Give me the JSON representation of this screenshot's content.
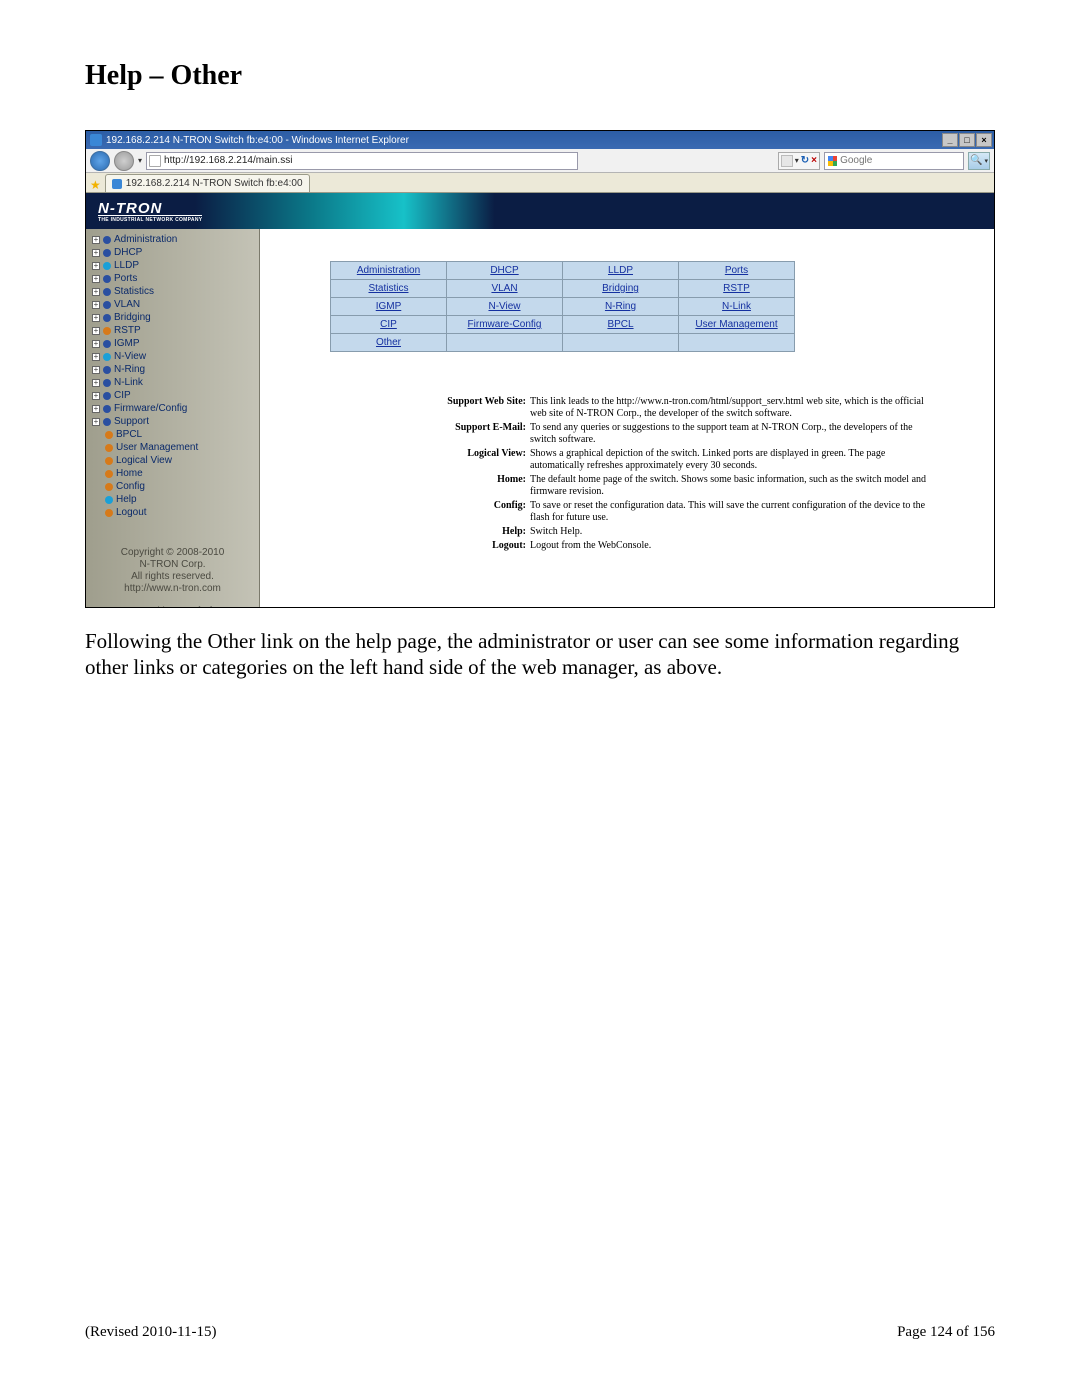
{
  "doc_title": "Help – Other",
  "ie": {
    "title": "192.168.2.214 N-TRON Switch fb:e4:00 - Windows Internet Explorer",
    "address": "http://192.168.2.214/main.ssi",
    "tab_label": "192.168.2.214 N-TRON Switch fb:e4:00",
    "search_placeholder": "Google",
    "min_label": "_",
    "max_label": "□",
    "close_label": "×",
    "refresh_label": "↻",
    "stop_label": "×",
    "dd_label": "▾",
    "mag_label": "🔍"
  },
  "banner": {
    "logo": "N-TRON",
    "tagline": "THE INDUSTRIAL NETWORK COMPANY"
  },
  "sidebar": {
    "items": [
      {
        "exp": true,
        "bullet": "b-dblue",
        "label": "Administration"
      },
      {
        "exp": true,
        "bullet": "b-dblue",
        "label": "DHCP"
      },
      {
        "exp": true,
        "bullet": "b-lblue",
        "label": "LLDP"
      },
      {
        "exp": true,
        "bullet": "b-dblue",
        "label": "Ports"
      },
      {
        "exp": true,
        "bullet": "b-dblue",
        "label": "Statistics"
      },
      {
        "exp": true,
        "bullet": "b-dblue",
        "label": "VLAN"
      },
      {
        "exp": true,
        "bullet": "b-dblue",
        "label": "Bridging"
      },
      {
        "exp": true,
        "bullet": "b-org",
        "label": "RSTP"
      },
      {
        "exp": true,
        "bullet": "b-dblue",
        "label": "IGMP"
      },
      {
        "exp": true,
        "bullet": "b-lblue",
        "label": "N-View"
      },
      {
        "exp": true,
        "bullet": "b-dblue",
        "label": "N-Ring"
      },
      {
        "exp": true,
        "bullet": "b-dblue",
        "label": "N-Link"
      },
      {
        "exp": true,
        "bullet": "b-dblue",
        "label": "CIP"
      },
      {
        "exp": true,
        "bullet": "b-dblue",
        "label": "Firmware/Config"
      },
      {
        "exp": true,
        "bullet": "b-dblue",
        "label": "Support"
      },
      {
        "exp": false,
        "bullet": "b-org",
        "label": "BPCL"
      },
      {
        "exp": false,
        "bullet": "b-org",
        "label": "User Management"
      },
      {
        "exp": false,
        "bullet": "b-org",
        "label": "Logical View"
      },
      {
        "exp": false,
        "bullet": "b-org",
        "label": "Home"
      },
      {
        "exp": false,
        "bullet": "b-org",
        "label": "Config"
      },
      {
        "exp": false,
        "bullet": "b-lblue",
        "label": "Help"
      },
      {
        "exp": false,
        "bullet": "b-org",
        "label": "Logout"
      }
    ]
  },
  "copyright": {
    "line1": "Copyright © 2008-2010",
    "line2": "N-TRON Corp.",
    "line3": "All rights reserved.",
    "line4": "http://www.n-tron.com"
  },
  "logged_in_prefix": "Logged in as: ",
  "logged_in_user": "admin",
  "grid": {
    "r0c0": "Administration",
    "r0c1": "DHCP",
    "r0c2": "LLDP",
    "r0c3": "Ports",
    "r1c0": "Statistics",
    "r1c1": "VLAN",
    "r1c2": "Bridging",
    "r1c3": "RSTP",
    "r2c0": "IGMP",
    "r2c1": "N-View",
    "r2c2": "N-Ring",
    "r2c3": "N-Link",
    "r3c0": "CIP",
    "r3c1": "Firmware-Config",
    "r3c2": "BPCL",
    "r3c3": "User Management",
    "r4c0": "Other"
  },
  "defs": [
    {
      "term": "Support Web Site:",
      "desc": "This link leads to the http://www.n-tron.com/html/support_serv.html web site, which is the official web site of N-TRON Corp., the developer of the switch software."
    },
    {
      "term": "Support E-Mail:",
      "desc": "To send any queries or suggestions to the support team at N-TRON Corp., the developers of the switch software."
    },
    {
      "term": "Logical View:",
      "desc": "Shows a graphical depiction of the switch. Linked ports are displayed in green. The page automatically refreshes approximately every 30 seconds."
    },
    {
      "term": "Home:",
      "desc": "The default home page of the switch. Shows some basic information, such as the switch model and firmware revision."
    },
    {
      "term": "Config:",
      "desc": "To save or reset the configuration data. This will save the current configuration of the device to the flash for future use."
    },
    {
      "term": "Help:",
      "desc": "Switch Help."
    },
    {
      "term": "Logout:",
      "desc": "Logout from the WebConsole."
    }
  ],
  "desc_text": "Following the Other link on the help page, the administrator or user can see some information regarding other links or categories on the left hand side of the web manager, as above.",
  "footer": {
    "revised": "(Revised 2010-11-15)",
    "page": "Page 124 of 156"
  }
}
